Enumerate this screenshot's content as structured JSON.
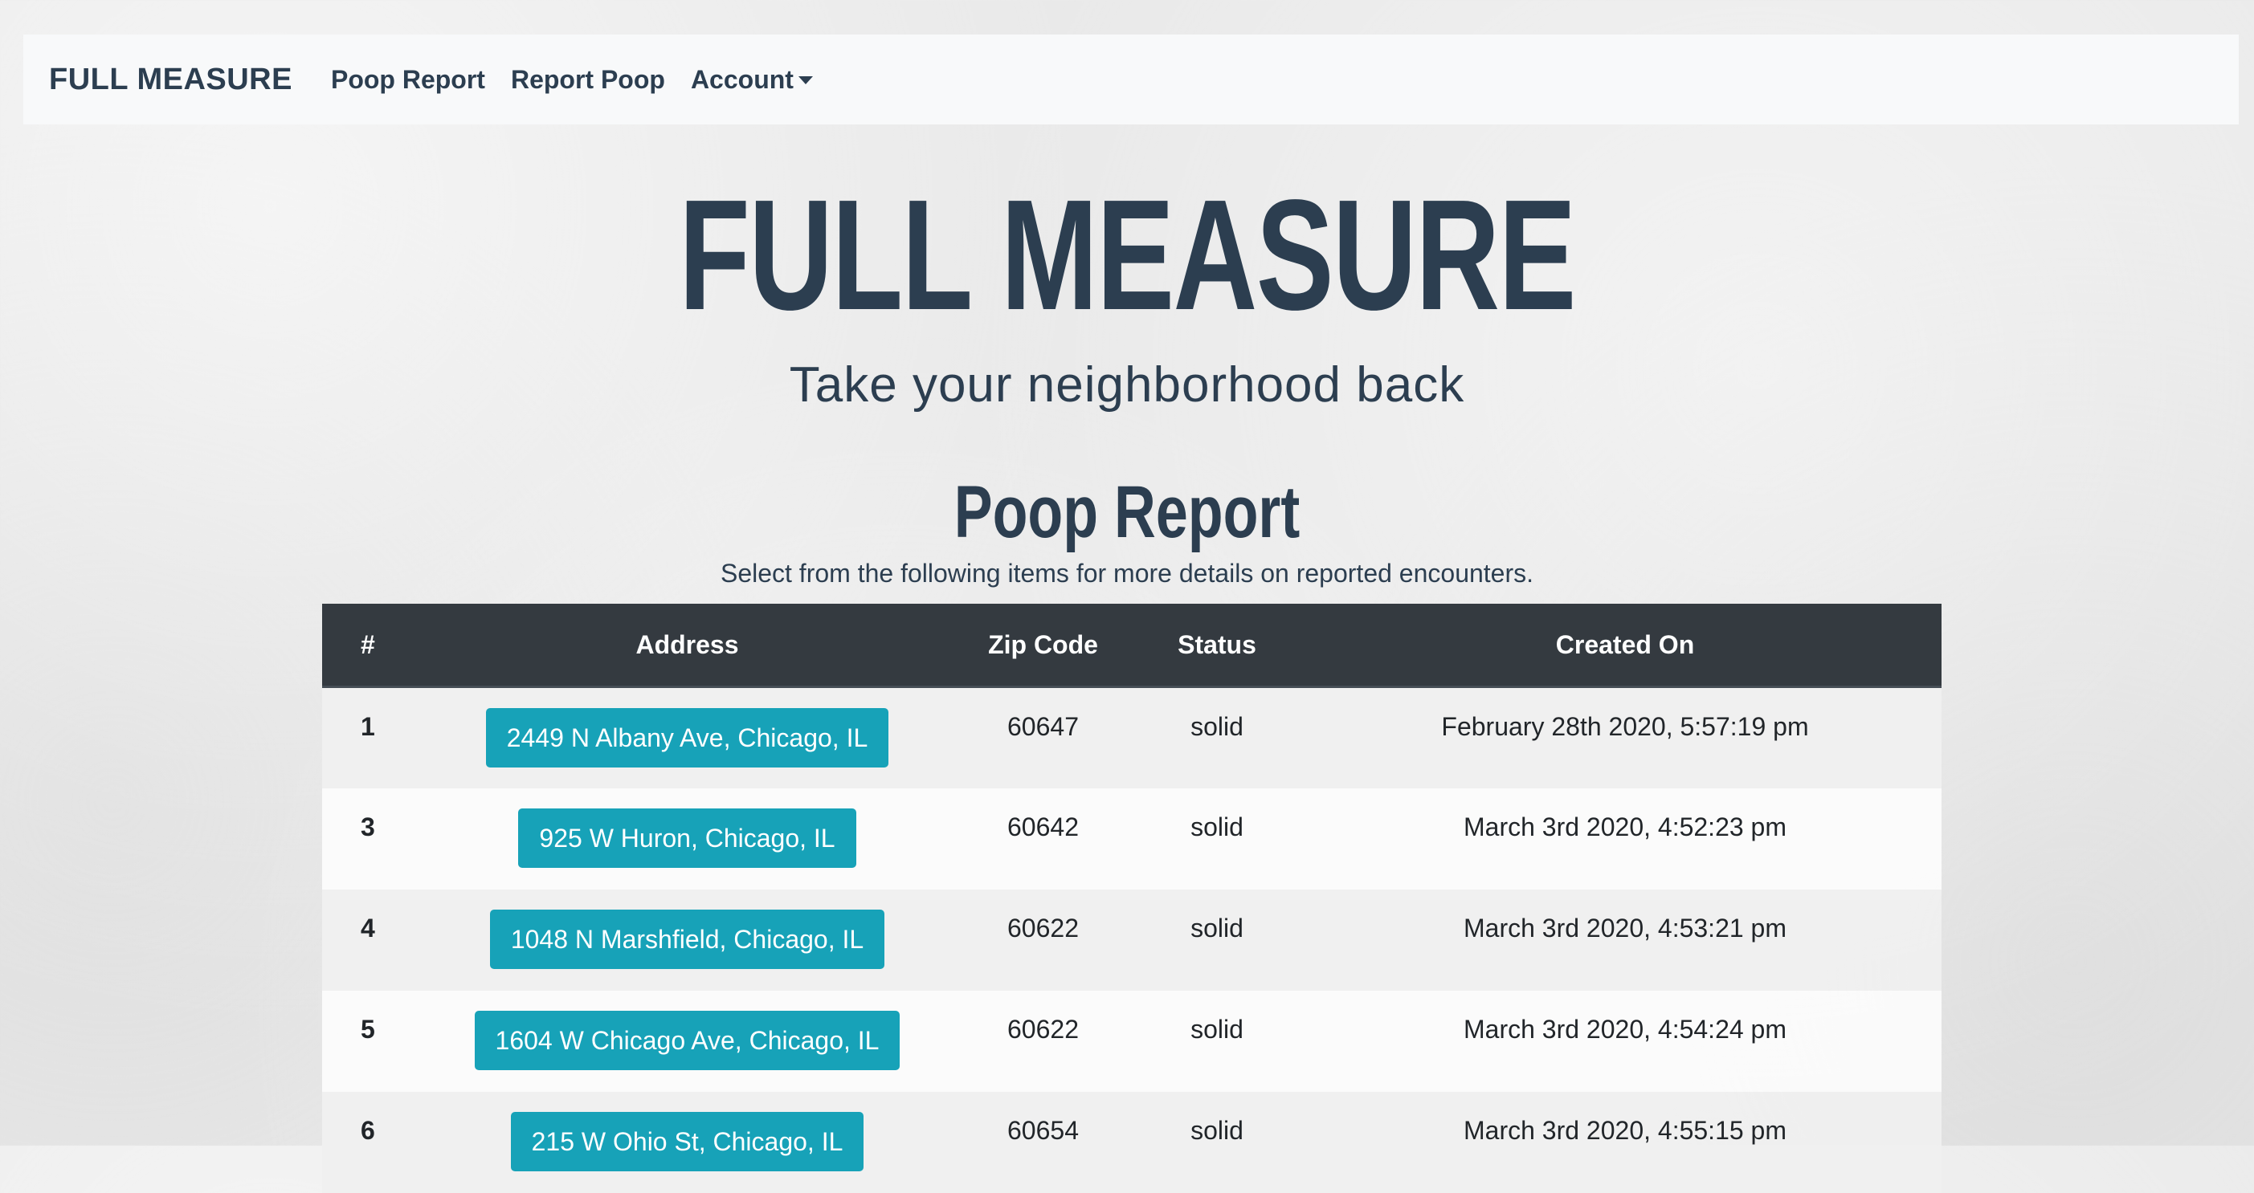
{
  "navbar": {
    "brand": "FULL MEASURE",
    "links": [
      {
        "label": "Poop Report"
      },
      {
        "label": "Report Poop"
      },
      {
        "label": "Account"
      }
    ]
  },
  "hero": {
    "title": "FULL MEASURE",
    "subtitle": "Take your neighborhood back"
  },
  "report": {
    "title": "Poop Report",
    "description": "Select from the following items for more details on reported encounters.",
    "columns": [
      "#",
      "Address",
      "Zip Code",
      "Status",
      "Created On"
    ],
    "rows": [
      {
        "num": "1",
        "address": "2449 N Albany Ave, Chicago, IL",
        "zip": "60647",
        "status": "solid",
        "created": "February 28th 2020, 5:57:19 pm"
      },
      {
        "num": "3",
        "address": "925 W Huron, Chicago, IL",
        "zip": "60642",
        "status": "solid",
        "created": "March 3rd 2020, 4:52:23 pm"
      },
      {
        "num": "4",
        "address": "1048 N Marshfield, Chicago, IL",
        "zip": "60622",
        "status": "solid",
        "created": "March 3rd 2020, 4:53:21 pm"
      },
      {
        "num": "5",
        "address": "1604 W Chicago Ave, Chicago, IL",
        "zip": "60622",
        "status": "solid",
        "created": "March 3rd 2020, 4:54:24 pm"
      },
      {
        "num": "6",
        "address": "215 W Ohio St, Chicago, IL",
        "zip": "60654",
        "status": "solid",
        "created": "March 3rd 2020, 4:55:15 pm"
      }
    ]
  },
  "colors": {
    "primary_text": "#2c3e50",
    "table_header_bg": "#343a40",
    "address_button_bg": "#17a2b8",
    "navbar_bg": "#f8f9fa"
  }
}
